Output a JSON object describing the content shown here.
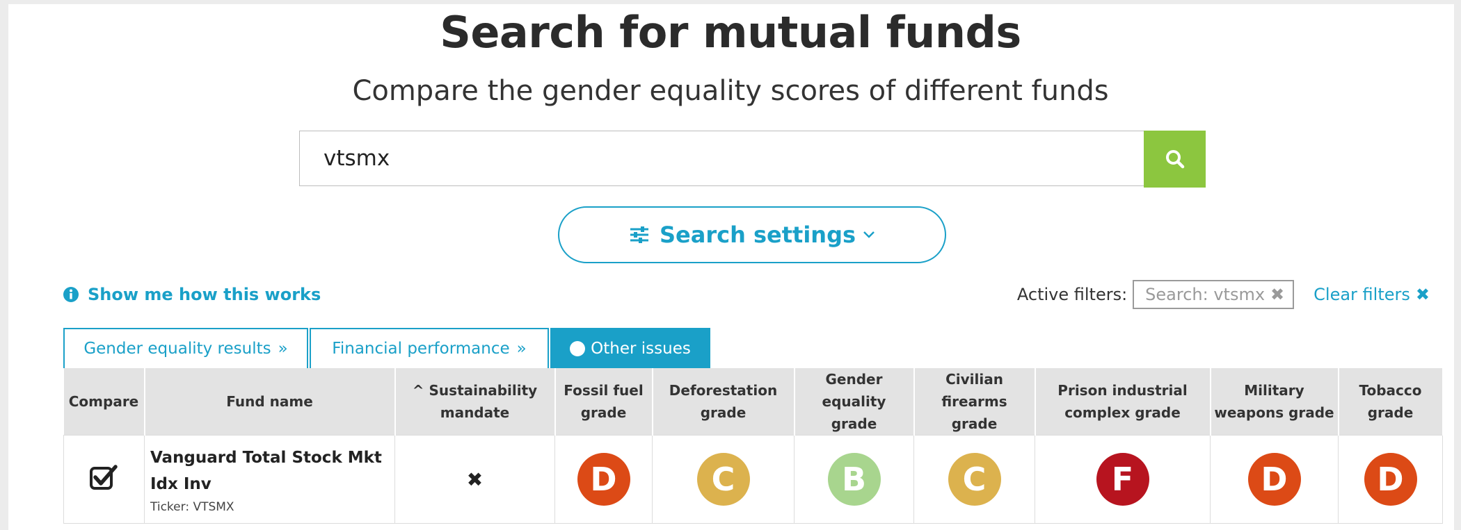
{
  "header": {
    "title": "Search for mutual funds",
    "subtitle": "Compare the gender equality scores of different funds"
  },
  "search": {
    "value": "vtsmx",
    "button_icon": "search-icon"
  },
  "settings": {
    "label": "Search settings",
    "icon": "sliders-icon",
    "chevron": "chevron-down-icon"
  },
  "help": {
    "label": "Show me how this works",
    "icon": "info-icon"
  },
  "filters": {
    "label": "Active filters:",
    "chips": [
      "Search: vtsmx"
    ],
    "remove_glyph": "✖",
    "clear_label": "Clear filters",
    "clear_glyph": "✖"
  },
  "tabs": [
    {
      "label": "Gender equality results",
      "glyph": "»",
      "active": false
    },
    {
      "label": "Financial performance",
      "glyph": "»",
      "active": false
    },
    {
      "label": "Other issues",
      "active": true
    }
  ],
  "table": {
    "sort_glyph": "^",
    "columns": [
      {
        "key": "compare",
        "label": "Compare"
      },
      {
        "key": "fund",
        "label": "Fund name"
      },
      {
        "key": "sustainability",
        "label": "Sustainability mandate",
        "sorted": true
      },
      {
        "key": "fossil",
        "label": "Fossil fuel grade"
      },
      {
        "key": "deforestation",
        "label": "Deforestation grade"
      },
      {
        "key": "gender",
        "label": "Gender equality grade"
      },
      {
        "key": "firearms",
        "label": "Civilian firearms grade"
      },
      {
        "key": "prison",
        "label": "Prison industrial complex grade"
      },
      {
        "key": "military",
        "label": "Military weapons grade"
      },
      {
        "key": "tobacco",
        "label": "Tobacco grade"
      }
    ],
    "rows": [
      {
        "compare_checked": true,
        "fund_name": "Vanguard Total Stock Mkt Idx Inv",
        "ticker": "Ticker: VTSMX",
        "sustainability_mandate": "✖",
        "grades": {
          "fossil": "D",
          "deforestation": "C",
          "gender": "B",
          "firearms": "C",
          "prison": "F",
          "military": "D",
          "tobacco": "D"
        }
      }
    ]
  },
  "colors": {
    "accent": "#1aa0c8",
    "search_button": "#8cc63f",
    "grade_B": "#a8d58e",
    "grade_C": "#dcb24e",
    "grade_D": "#dc4a16",
    "grade_F": "#b7141f"
  }
}
